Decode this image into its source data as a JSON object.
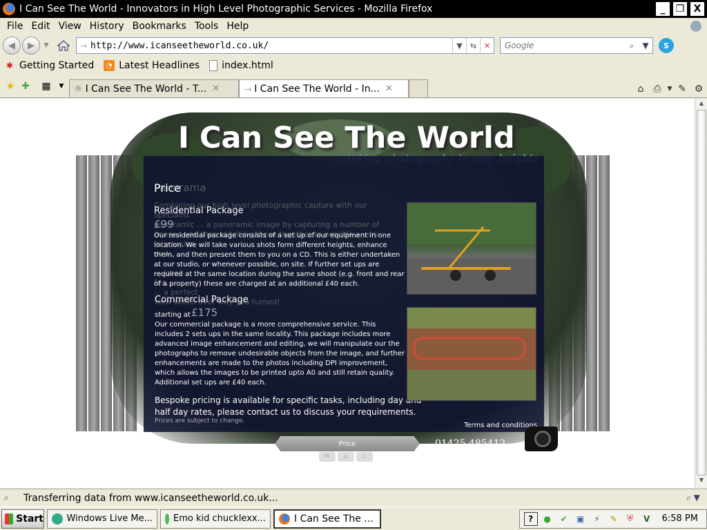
{
  "window": {
    "title": "I Can See The World - Innovators in High Level Photographic Services - Mozilla Firefox",
    "min": "_",
    "max": "❐",
    "close": "X"
  },
  "menu": [
    "File",
    "Edit",
    "View",
    "History",
    "Bookmarks",
    "Tools",
    "Help"
  ],
  "nav": {
    "back": "◀",
    "forward": "▶",
    "url": "http://www.icanseetheworld.co.uk/",
    "search_placeholder": "Google"
  },
  "bookmarks": [
    {
      "label": "Getting Started",
      "icon": "getting-started-icon"
    },
    {
      "label": "Latest Headlines",
      "icon": "rss-icon"
    },
    {
      "label": "index.html",
      "icon": "page-icon"
    }
  ],
  "tabs": [
    {
      "label": "I Can See The World - T...",
      "active": false
    },
    {
      "label": "I Can See The World - In...",
      "active": true
    }
  ],
  "site": {
    "title": "I Can See The World",
    "tagline": "...taking photography to new heights",
    "ghost_heading": "Panorama",
    "ghost_text": "Combining our high level photographic capture with our specialist\npanoramic ... a panoramic image by capturing a number of\nimages and then stitching these together to provide a very impressive\nand ...\n...\n... local\nfea...\n... a perfect\nview which ever way you turned!",
    "price_heading": "Price",
    "residential": {
      "title": "Residential Package",
      "price": "£99",
      "body": "Our residential package consists of a set up of our equipment in one location. We will take various shots form different heights, enhance them, and then present them to you on a CD. This is either undertaken at our studio, or whenever possible, on site. If further set ups are required at the same location during the same shoot (e.g. front and rear of a property) these are charged at an additional £40 each."
    },
    "commercial": {
      "title": "Commercial Package",
      "starting": "starting at",
      "price": "£175",
      "body": "Our commercial package is a more comprehensive service. This includes 2 sets ups in the same locality. This package includes more advanced image enhancement and editing, we will manipulate our the photographs to remove undesirable objects from the image, and further enhancements are made to the photos including DPI improvement, which allows the images to be printed upto A0 and still retain quality. Additional set ups are £40 each."
    },
    "bespoke": "Bespoke pricing is available for specific tasks, including day and half day rates, please contact us to discuss your requirements.",
    "subject_to_change": "Prices are subject to change.",
    "terms": "Terms and conditions",
    "nav_tab": "Price",
    "phone": "01425 485412"
  },
  "status": {
    "text": "Transferring data from www.icanseetheworld.co.uk..."
  },
  "taskbar": {
    "start": "Start",
    "tasks": [
      {
        "label": "Windows Live Me...",
        "active": false
      },
      {
        "label": "Emo kid chucklexx...",
        "active": false
      },
      {
        "label": "I Can See The ...",
        "active": true
      }
    ],
    "clock": "6:58 PM"
  },
  "colors": {
    "panel": "#0e1230",
    "tagline": "#6d7fa6",
    "titlebar": "#000000"
  }
}
